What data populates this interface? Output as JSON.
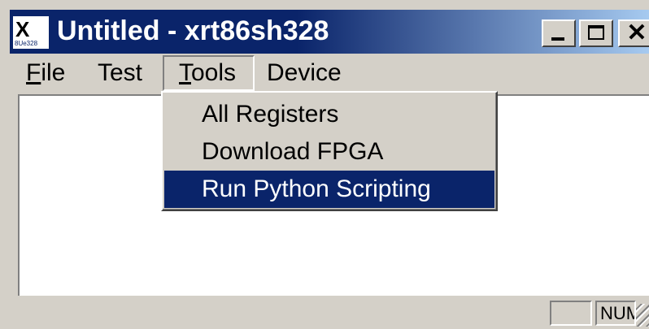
{
  "window": {
    "title": "Untitled - xrt86sh328",
    "icon": "xr-app-icon",
    "icon_text": "8Ue328",
    "caption_buttons": {
      "minimize": "_",
      "maximize": "□",
      "close": "✕"
    }
  },
  "menubar": {
    "items": [
      {
        "id": "file",
        "first": "F",
        "rest": "ile"
      },
      {
        "id": "test",
        "first": "",
        "rest": "Test"
      },
      {
        "id": "tools",
        "first": "T",
        "rest": "ools"
      },
      {
        "id": "device",
        "first": "",
        "rest": "Device"
      }
    ],
    "open_menu": "Tools"
  },
  "dropdown": {
    "items": [
      {
        "label": "All Registers"
      },
      {
        "label": "Download FPGA"
      },
      {
        "label": "Run Python Scripting",
        "highlighted": true
      }
    ]
  },
  "statusbar": {
    "num_indicator": "NUM"
  },
  "colors": {
    "titlebar_start": "#0a246a",
    "titlebar_end": "#a6caf0",
    "highlight": "#0a246a",
    "face": "#d4d0c8"
  }
}
